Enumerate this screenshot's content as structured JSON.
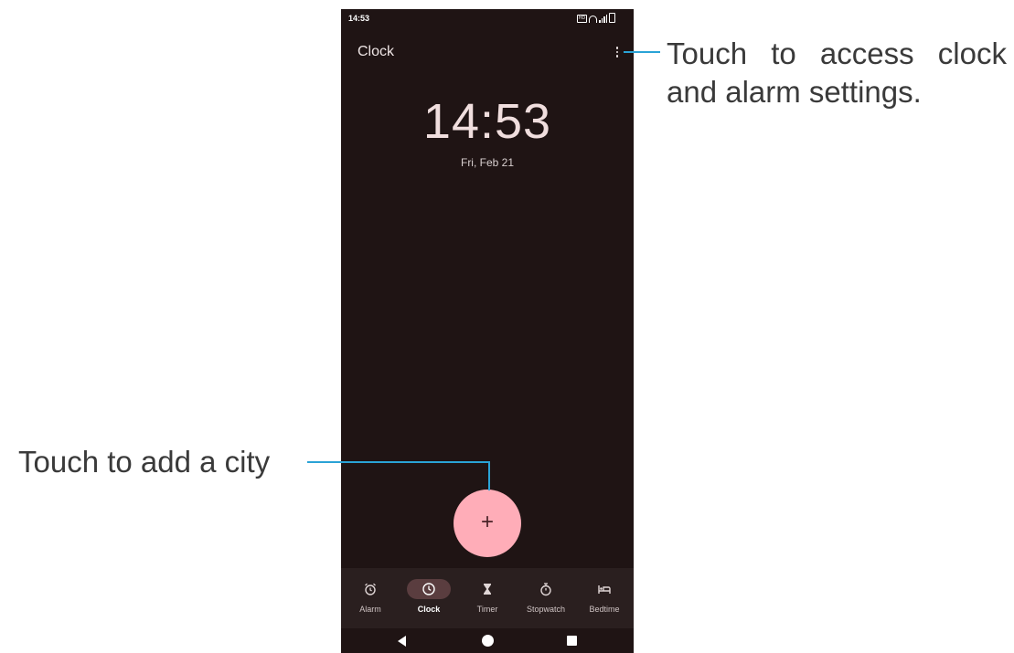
{
  "status_bar": {
    "time": "14:53"
  },
  "app_bar": {
    "title": "Clock",
    "menu_icon": "more-vert-icon"
  },
  "clock": {
    "time": "14:53",
    "date": "Fri, Feb 21"
  },
  "fab": {
    "label": "+"
  },
  "bottom_nav": {
    "items": [
      {
        "label": "Alarm",
        "icon": "alarm-icon",
        "active": false
      },
      {
        "label": "Clock",
        "icon": "clock-icon",
        "active": true
      },
      {
        "label": "Timer",
        "icon": "hourglass-icon",
        "active": false
      },
      {
        "label": "Stopwatch",
        "icon": "stopwatch-icon",
        "active": false
      },
      {
        "label": "Bedtime",
        "icon": "bed-icon",
        "active": false
      }
    ]
  },
  "system_nav": {
    "back_icon": "back-icon",
    "home_icon": "home-icon",
    "recents_icon": "recents-icon"
  },
  "callouts": {
    "settings": "Touch to access clock and alarm settings.",
    "add_city": "Touch to add a city"
  },
  "colors": {
    "screen_bg": "#1f1414",
    "fab": "#ffadb8",
    "nav_bg": "#2a1f1f",
    "active_pill": "#5a3d3f",
    "leader_line": "#2aa3d6"
  }
}
